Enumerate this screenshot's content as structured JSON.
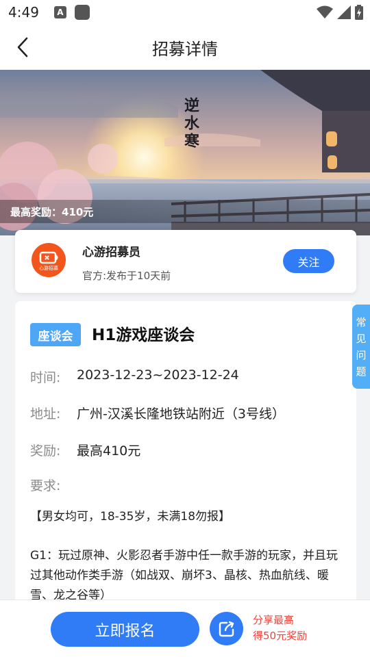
{
  "status_bar": {
    "time": "4:49",
    "notification_icon": "A",
    "icons": [
      "app-square-icon",
      "wifi-icon",
      "signal-icon",
      "battery-icon"
    ]
  },
  "header": {
    "title": "招募详情",
    "back_icon": "chevron-left-icon"
  },
  "banner": {
    "calligraphy": "逆水寒",
    "reward_text": "最高奖励：410元"
  },
  "publisher": {
    "name": "心游招募员",
    "meta": "官方:发布于10天前",
    "logo_text": "心游招募",
    "follow_label": "关注"
  },
  "event": {
    "tag": "座谈会",
    "title": "H1游戏座谈会",
    "time_label": "时间:",
    "time_value": "2023-12-23~2023-12-24",
    "address_label": "地址:",
    "address_value": "广州-汉溪长隆地铁站附近（3号线）",
    "reward_label": "奖励:",
    "reward_value": "最高410元",
    "requirement_label": "要求:",
    "requirement_line": "【男女均可，18-35岁，未满18勿报】",
    "requirement_para": "G1：玩过原神、火影忍者手游中任一款手游的玩家，并且玩过其他动作类手游（如战双、崩坏3、晶核、热血航线、暖雪、龙之谷等）"
  },
  "faq_tab": {
    "chars": [
      "常",
      "见",
      "问",
      "题"
    ]
  },
  "bottom_bar": {
    "signup_label": "立即报名",
    "share_icon": "share-icon",
    "share_line1": "分享最高",
    "share_line2": "得50元奖励"
  },
  "colors": {
    "primary": "#2f7cf6",
    "tag": "#4ea6f6",
    "faq": "#51aef7",
    "share_text": "#e8453c",
    "logo": "#f2561d"
  }
}
